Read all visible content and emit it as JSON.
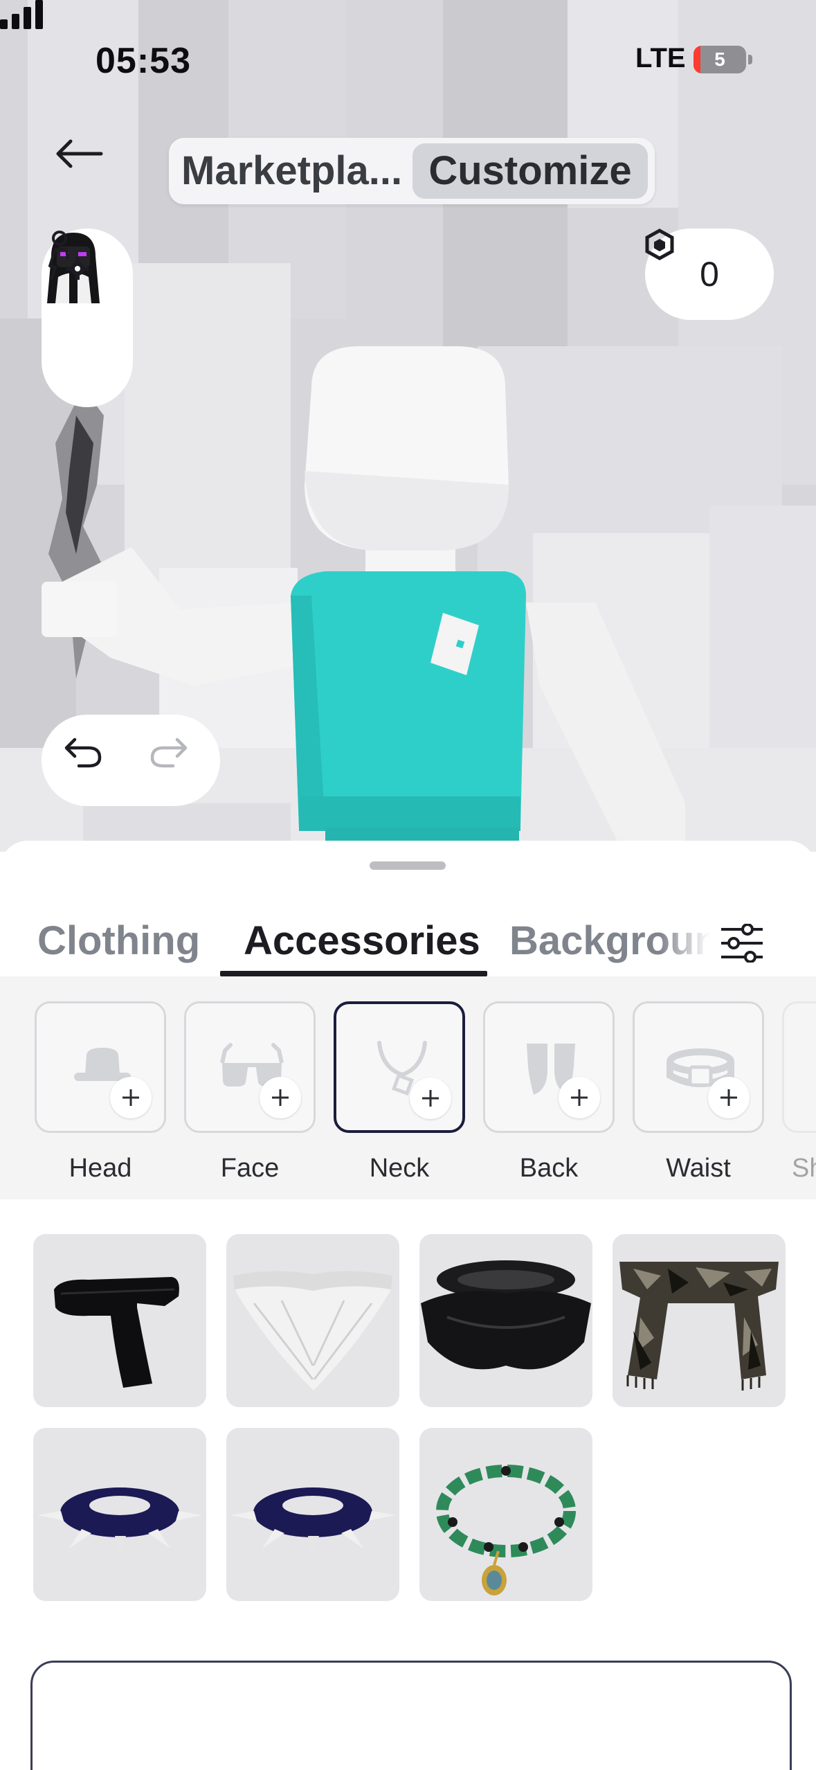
{
  "status": {
    "time": "05:53",
    "network": "LTE",
    "battery": "5",
    "icons": [
      "signal-bars-icon",
      "battery-icon"
    ]
  },
  "header": {
    "back_icon": "arrow-left-icon",
    "segments": [
      {
        "label": "Marketpla...",
        "active": false
      },
      {
        "label": "Customize",
        "active": true
      }
    ]
  },
  "robux": {
    "icon": "robux-hexagon-icon",
    "balance": "0"
  },
  "avatar_panel": {
    "icons": [
      "avatar-thumbnail",
      "avatar-settings-icon"
    ]
  },
  "history": {
    "undo_icon": "undo-icon",
    "redo_icon": "redo-icon"
  },
  "tabs": {
    "items": [
      {
        "label": "Clothing",
        "active": false
      },
      {
        "label": "Accessories",
        "active": true
      },
      {
        "label": "Background",
        "active": false
      }
    ],
    "filter_icon": "sliders-icon"
  },
  "categories": [
    {
      "label": "Head",
      "icon": "hat-icon",
      "selected": false
    },
    {
      "label": "Face",
      "icon": "glasses-icon",
      "selected": false
    },
    {
      "label": "Neck",
      "icon": "necklace-icon",
      "selected": true
    },
    {
      "label": "Back",
      "icon": "wings-icon",
      "selected": false
    },
    {
      "label": "Waist",
      "icon": "belt-icon",
      "selected": false
    },
    {
      "label": "Sh",
      "icon": "shoulder-icon",
      "selected": false
    }
  ],
  "items": [
    {
      "name": "black-scarf"
    },
    {
      "name": "white-bandana"
    },
    {
      "name": "black-neck-wrap"
    },
    {
      "name": "camo-scarf"
    },
    {
      "name": "spiked-collar-1"
    },
    {
      "name": "spiked-collar-2"
    },
    {
      "name": "green-bead-necklace"
    }
  ],
  "colors": {
    "accent": "#1a1d3b",
    "shirt": "#2fcfc9",
    "sheet": "#ffffff",
    "tile": "#e5e5e8"
  }
}
